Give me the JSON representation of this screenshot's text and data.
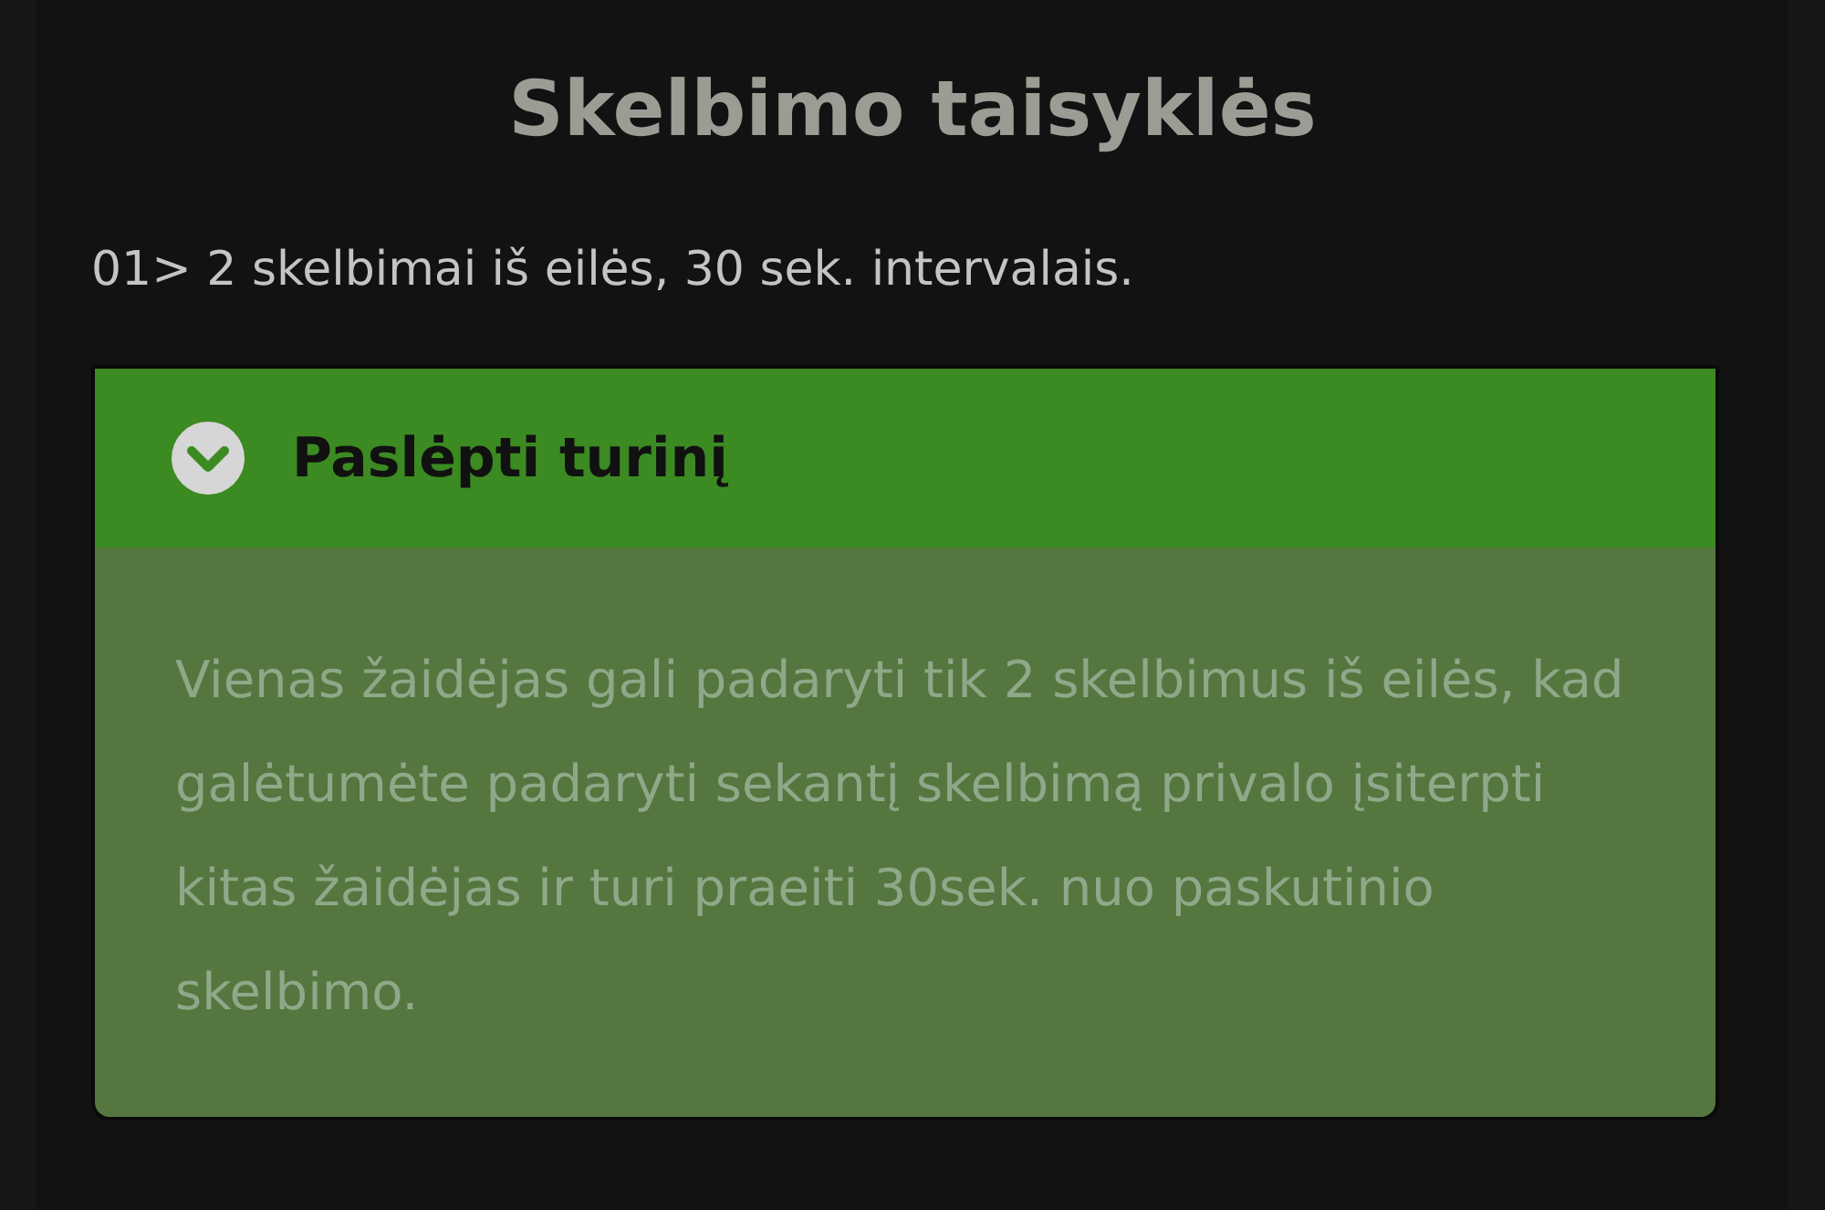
{
  "title": "Skelbimo taisyklės",
  "rule": "01> 2 skelbimai iš eilės, 30 sek. intervalais.",
  "accordion": {
    "label": "Paslėpti turinį",
    "expanded": true,
    "body": "Vienas žaidėjas gali padaryti tik 2 skelbimus iš eilės, kad galėtumėte padaryti sekantį skelbimą privalo įsiterpti kitas žaidėjas ir turi praeiti 30sek. nuo paskutinio skelbimo."
  }
}
